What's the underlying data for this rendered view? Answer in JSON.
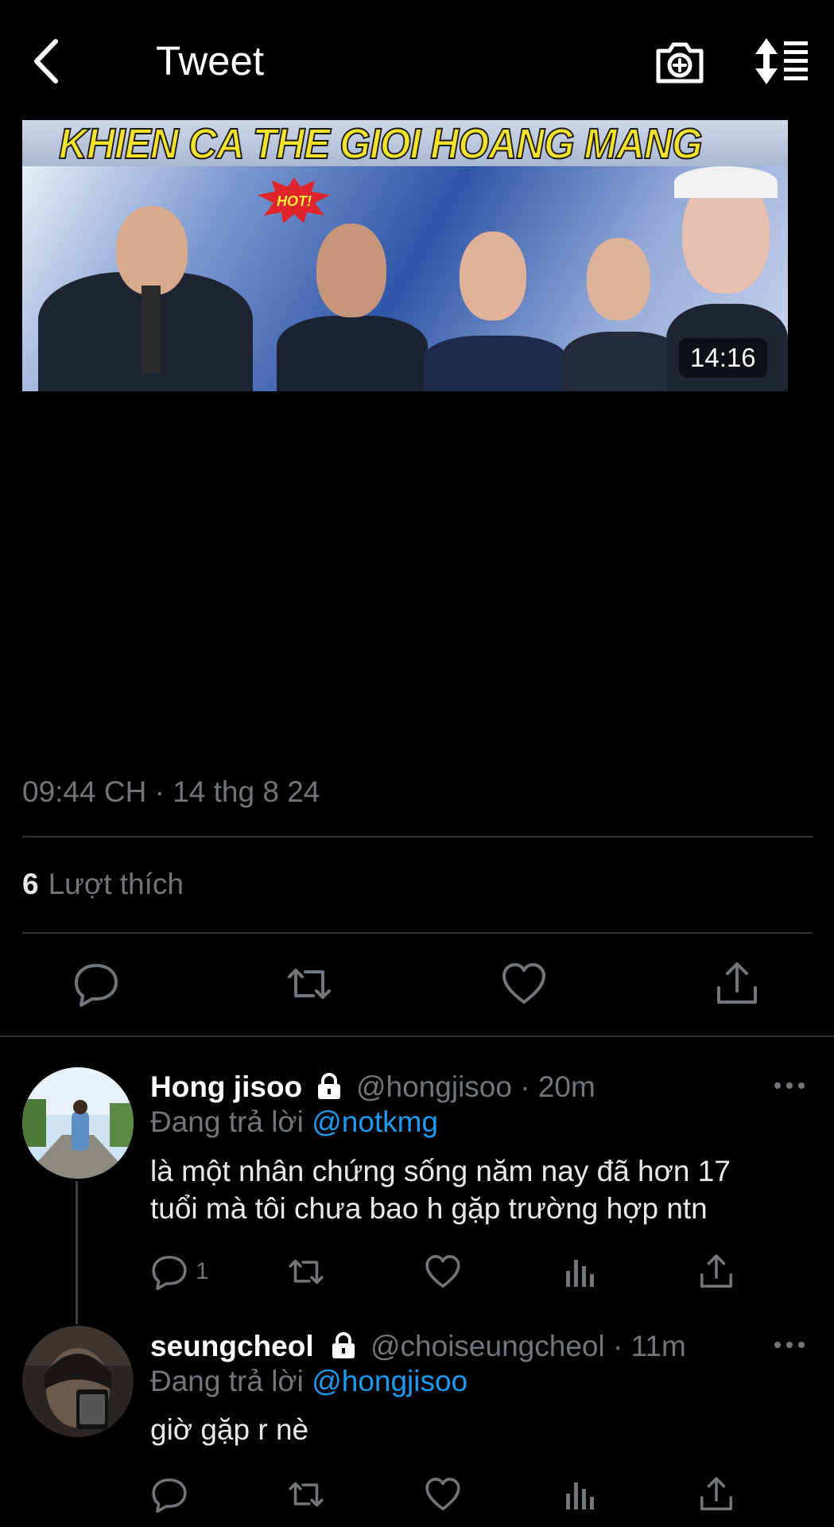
{
  "header": {
    "title": "Tweet",
    "back_icon": "chevron-left-icon",
    "camera_icon": "camera-plus-icon",
    "sort_icon": "sort-icon"
  },
  "media": {
    "headline": "KHIEN CA THE GIOI HOANG MANG",
    "badge": "HOT!",
    "duration": "14:16"
  },
  "tweet": {
    "timestamp": "09:44 CH · 14 thg 8 24",
    "likes_count": "6",
    "likes_label": "Lượt thích"
  },
  "actions": {
    "reply_icon": "reply-icon",
    "retweet_icon": "retweet-icon",
    "like_icon": "heart-icon",
    "share_icon": "share-icon"
  },
  "replies": [
    {
      "name": "Hong jisoo",
      "handle": "@hongjisoo · 20m",
      "replying_prefix": "Đang trả lời",
      "replying_to": "@notkmg",
      "text_line1": "là một nhân chứng sống năm nay đã hơn 17",
      "text_line2": "tuổi mà tôi chưa bao h gặp trường hợp ntn",
      "reply_count": "1"
    },
    {
      "name": "seungcheol",
      "handle": "@choiseungcheol · 11m",
      "replying_prefix": "Đang trả lời",
      "replying_to": "@hongjisoo",
      "text_line1": "giờ gặp r nè",
      "reply_count": ""
    }
  ],
  "colors": {
    "background": "#000000",
    "text": "#e7e9ea",
    "muted": "#71767b",
    "accent": "#1d9bf0",
    "divider": "#2f3336"
  }
}
